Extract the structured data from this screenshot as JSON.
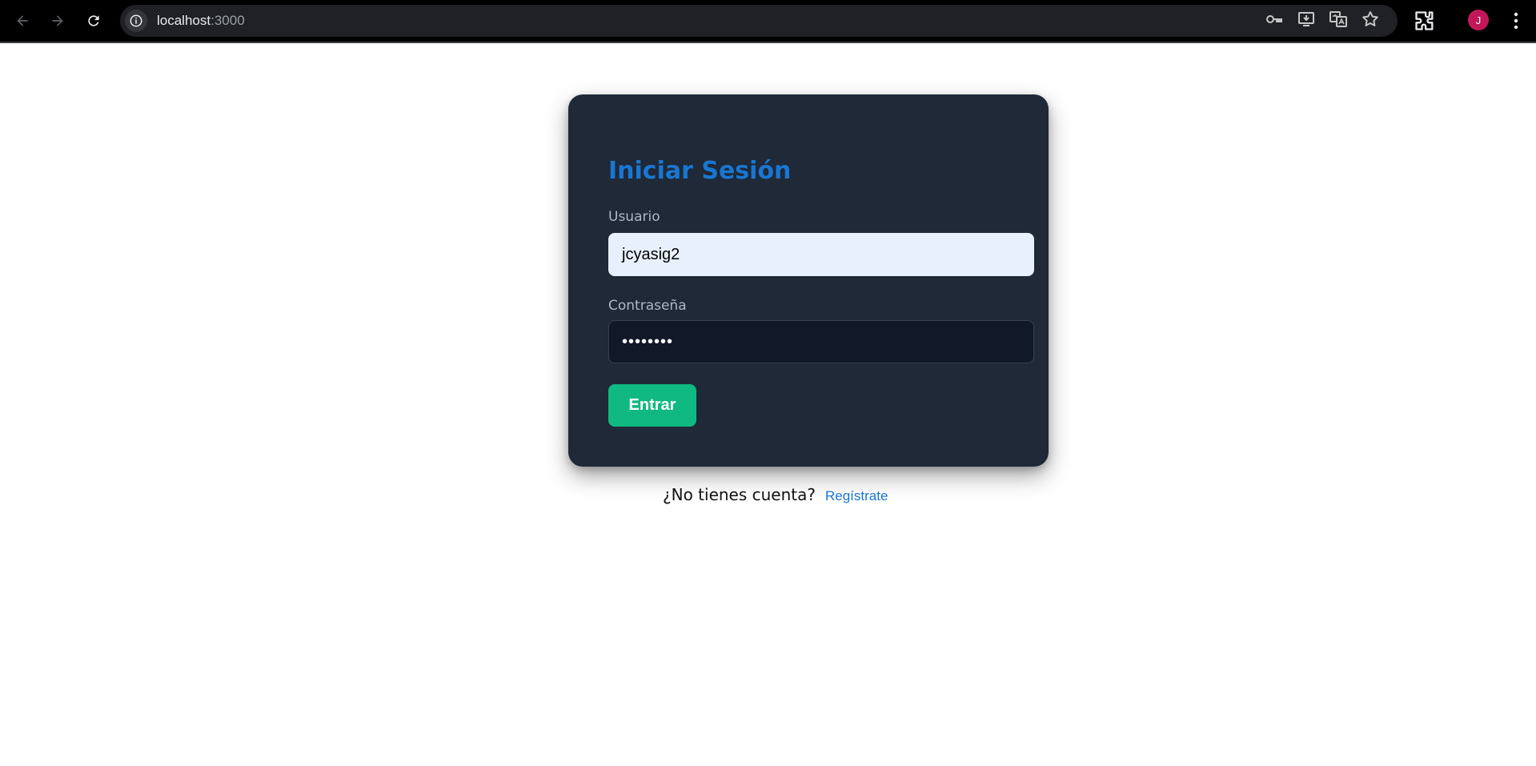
{
  "browser": {
    "url_host": "localhost",
    "url_port": ":3000",
    "profile_initial": "J",
    "icons": [
      "back-icon",
      "forward-icon",
      "reload-icon",
      "site-info-icon",
      "key-icon",
      "install-app-icon",
      "translate-icon",
      "bookmark-star-icon",
      "extensions-icon",
      "menu-icon"
    ]
  },
  "login": {
    "title": "Iniciar Sesión",
    "username_label": "Usuario",
    "username_value": "jcyasig2",
    "password_label": "Contraseña",
    "password_mask": "••••••••",
    "submit_label": "Entrar"
  },
  "footer": {
    "question": "¿No tienes cuenta?",
    "register_link": "Regístrate"
  },
  "colors": {
    "card_bg": "#1f2937",
    "title": "#1976d2",
    "button": "#10b981",
    "avatar": "#c2185b"
  }
}
